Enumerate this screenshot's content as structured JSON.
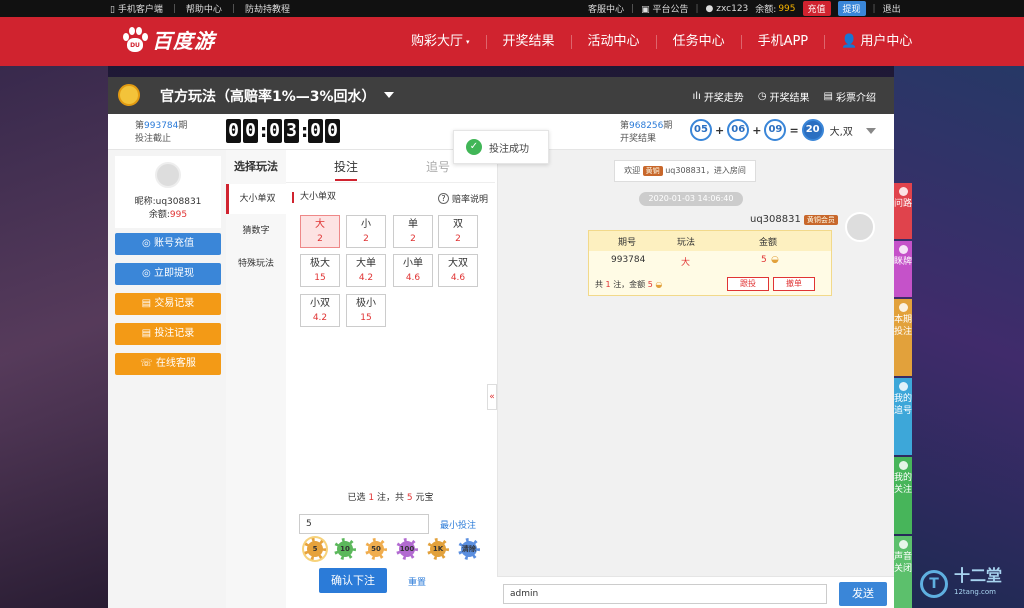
{
  "topbar": {
    "mobile_client": "手机客户端",
    "help_center": "帮助中心",
    "anti_hijack": "防劫持教程",
    "customer_service": "客服中心",
    "announcement": "平台公告",
    "username": "zxc123",
    "balance_label": "余额:",
    "balance_value": "995",
    "recharge": "充值",
    "withdraw": "提现",
    "logout": "退出"
  },
  "header": {
    "logo_text": "百度游",
    "logo_badge": "DU",
    "nav": [
      {
        "label": "购彩大厅"
      },
      {
        "label": "开奖结果"
      },
      {
        "label": "活动中心"
      },
      {
        "label": "任务中心"
      },
      {
        "label": "手机APP"
      },
      {
        "label": "用户中心"
      }
    ]
  },
  "game": {
    "title": "官方玩法（高赔率1%—3%回水）",
    "links": {
      "trend": "开奖走势",
      "results": "开奖结果",
      "intro": "彩票介绍"
    },
    "current": {
      "prefix": "第",
      "issue": "993784",
      "suffix": "期",
      "label": "投注截止"
    },
    "timer": [
      "0",
      "0",
      "0",
      "3",
      "0",
      "0"
    ],
    "last": {
      "prefix": "第",
      "issue": "968256",
      "suffix": "期",
      "label": "开奖结果",
      "balls": [
        "05",
        "06",
        "09"
      ],
      "sum": "20",
      "result_text": "大,双",
      "plus": "+",
      "equals": "="
    }
  },
  "user": {
    "nickname_label": "昵称:",
    "nickname": "uq308831",
    "balance_label": "余额:",
    "balance": "995",
    "buttons": [
      "账号充值",
      "立即提现",
      "交易记录",
      "投注记录",
      "在线客服"
    ]
  },
  "play": {
    "heading": "选择玩法",
    "items": [
      "大小单双",
      "猜数字",
      "特殊玩法"
    ],
    "tab_bet": "投注",
    "tab_chase": "追号",
    "section": "大小单双",
    "odds_note": "赔率说明",
    "options": [
      {
        "name": "大",
        "odds": "2"
      },
      {
        "name": "小",
        "odds": "2"
      },
      {
        "name": "单",
        "odds": "2"
      },
      {
        "name": "双",
        "odds": "2"
      },
      {
        "name": "极大",
        "odds": "15"
      },
      {
        "name": "大单",
        "odds": "4.2"
      },
      {
        "name": "小单",
        "odds": "4.6"
      },
      {
        "name": "大双",
        "odds": "4.6"
      },
      {
        "name": "小双",
        "odds": "4.2"
      },
      {
        "name": "极小",
        "odds": "15"
      }
    ],
    "summary": {
      "a": "已选",
      "count": "1",
      "b": "注，共",
      "total": "5",
      "c": "元宝"
    },
    "amount": "5",
    "min_bet": "最小投注",
    "chips": [
      "5",
      "10",
      "50",
      "100",
      "1K",
      "清除"
    ],
    "confirm": "确认下注",
    "reset": "重置",
    "collapse": "«"
  },
  "toast": {
    "text": "投注成功",
    "icon": "✓"
  },
  "chat": {
    "welcome_pre": "欢迎",
    "welcome_badge": "黄铜",
    "welcome_post": "uq308831，进入房间",
    "timestamp": "2020-01-03 14:06:40",
    "sender": "uq308831",
    "sender_badge": "黄铜会员",
    "bet_headers": [
      "期号",
      "玩法",
      "金额"
    ],
    "bet_row": {
      "issue": "993784",
      "play": "大",
      "amount": "5"
    },
    "foot": {
      "a": "共",
      "count": "1",
      "b": "注，金额",
      "amount": "5"
    },
    "follow": "跟投",
    "cancel": "撤单",
    "input_value": "admin",
    "send": "发送"
  },
  "sidebar": [
    {
      "label": "问路",
      "color": "#e0434c"
    },
    {
      "label": "眯牌",
      "color": "#c552c9"
    },
    {
      "label": "本期投注",
      "color": "#e2a13b"
    },
    {
      "label": "我的追号",
      "color": "#3da7d9"
    },
    {
      "label": "我的关注",
      "color": "#47b55a"
    },
    {
      "label": "声音关闭",
      "color": "#5cc06c"
    }
  ],
  "watermark": {
    "mark": "T",
    "text": "十二堂",
    "url": "12tang.com"
  }
}
